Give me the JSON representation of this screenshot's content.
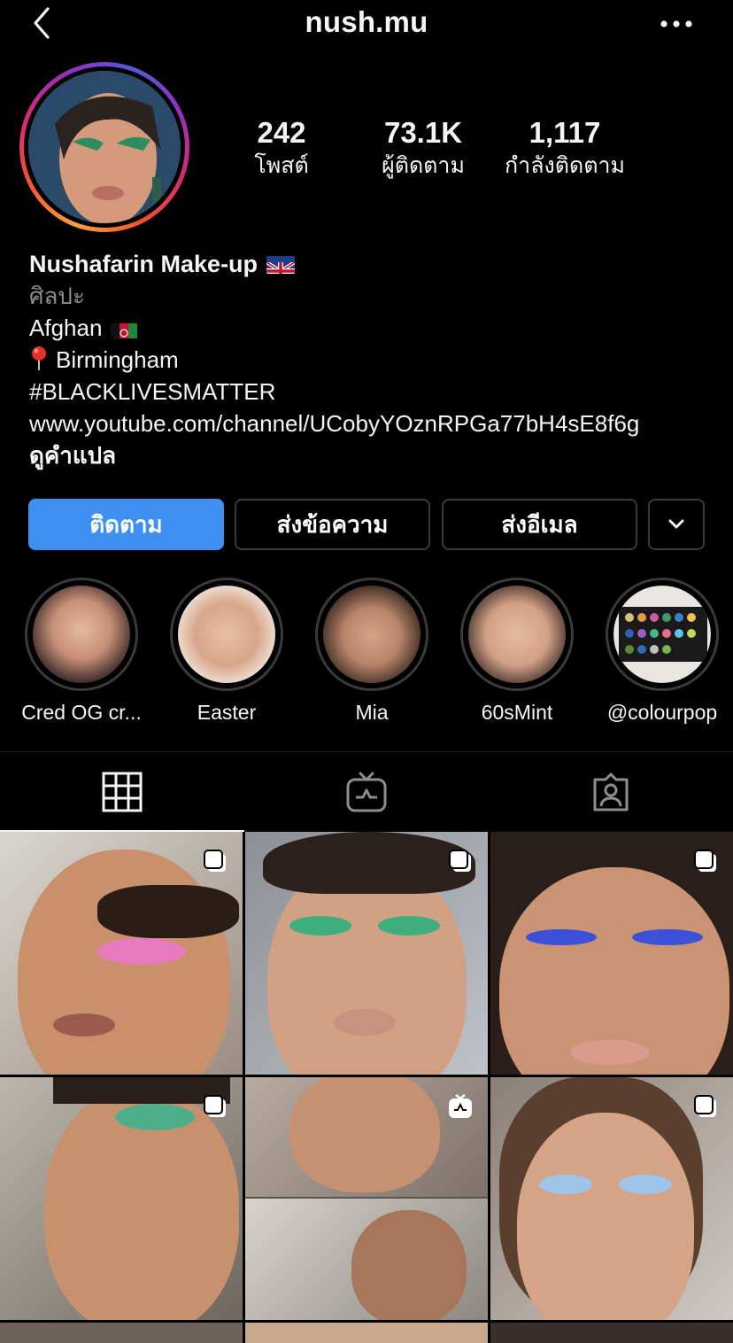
{
  "header": {
    "username": "nush.mu",
    "back_icon": "chevron-left-icon",
    "more_icon": "more-horizontal-icon"
  },
  "profile": {
    "stats": [
      {
        "value": "242",
        "label": "โพสต์"
      },
      {
        "value": "73.1K",
        "label": "ผู้ติดตาม"
      },
      {
        "value": "1,117",
        "label": "กำลังติดตาม"
      }
    ],
    "name": "Nushafarin Make-up",
    "category": "ศิลปะ",
    "bio_lines": [
      "Afghan",
      "Birmingham",
      "#BLACKLIVESMATTER"
    ],
    "link": "www.youtube.com/channel/UCobyYOznRPGa77bH4sE8f6g",
    "see_translation": "ดูคำแปล"
  },
  "actions": {
    "follow": "ติดตาม",
    "message": "ส่งข้อความ",
    "email": "ส่งอีเมล",
    "more_icon": "chevron-down-icon"
  },
  "highlights": [
    {
      "label": "Cred OG cr..."
    },
    {
      "label": "Easter"
    },
    {
      "label": "Mia"
    },
    {
      "label": "60sMint"
    },
    {
      "label": "@colourpop"
    }
  ],
  "tabs": [
    {
      "icon": "grid-icon",
      "active": true
    },
    {
      "icon": "igtv-icon",
      "active": false
    },
    {
      "icon": "tagged-icon",
      "active": false
    }
  ],
  "colors": {
    "background": "#000000",
    "primary_button": "#3d8ff0",
    "secondary_text": "#8e8e8e",
    "outline": "#3a3a3a"
  }
}
